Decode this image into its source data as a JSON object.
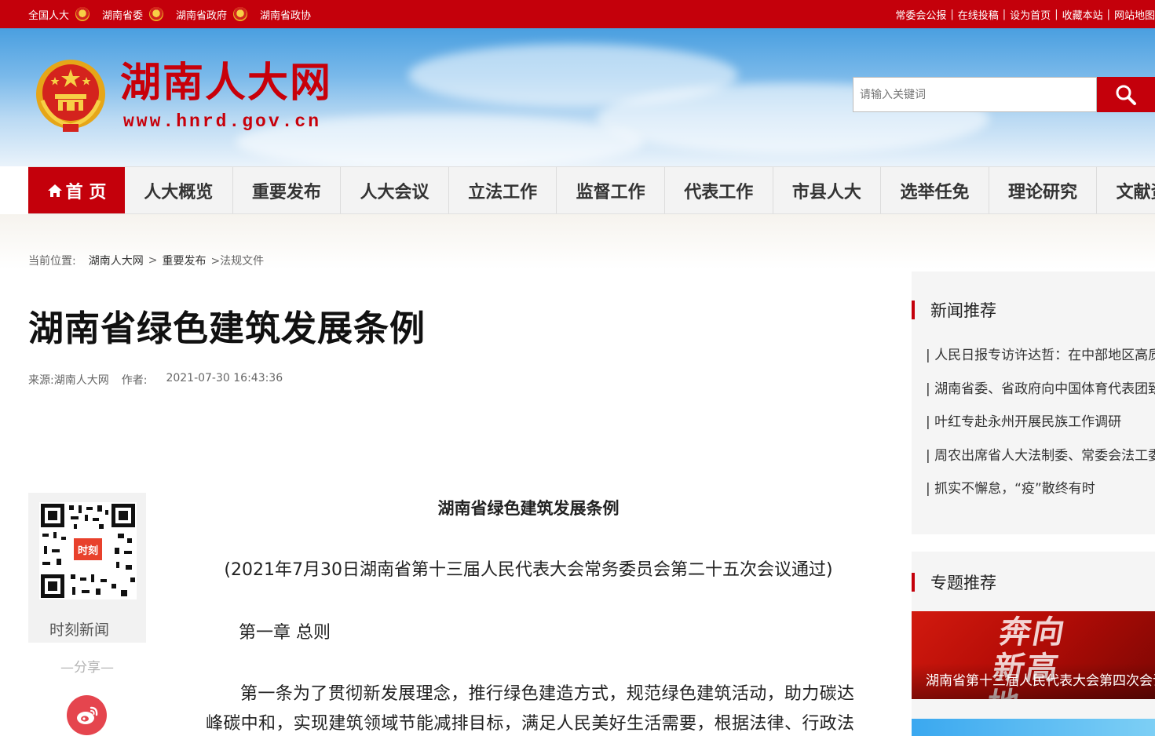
{
  "topbar": {
    "left_links": [
      "全国人大",
      "湖南省委",
      "湖南省政府",
      "湖南省政协"
    ],
    "right_links": [
      "常委会公报",
      "在线投稿",
      "设为首页",
      "收藏本站",
      "网站地图"
    ],
    "separator": "|"
  },
  "header": {
    "site_title": "湖南人大网",
    "site_url": "www.hnrd.gov.cn",
    "search_placeholder": "请输入关键词"
  },
  "nav": {
    "home_label": "首 页",
    "items": [
      "人大概览",
      "重要发布",
      "人大会议",
      "立法工作",
      "监督工作",
      "代表工作",
      "市县人大",
      "选举任免",
      "理论研究",
      "文献资料"
    ]
  },
  "breadcrumb": {
    "label": "当前位置:",
    "items": [
      "湖南人大网",
      "重要发布",
      ">法规文件"
    ],
    "arrow": ">"
  },
  "article": {
    "title": "湖南省绿色建筑发展条例",
    "source": "来源:湖南人大网",
    "author": "作者:",
    "datetime": "2021-07-30 16:43:36",
    "content_title": "湖南省绿色建筑发展条例",
    "subtitle": "(2021年7月30日湖南省第十三届人民代表大会常务委员会第二十五次会议通过)",
    "chapter": "第一章 总则",
    "paragraph1": "第一条为了贯彻新发展理念，推行绿色建造方式，规范绿色建筑活动，助力碳达峰碳中和，实现建筑领域节能减排目标，满足人民美好生活需要，根据法律、行政法规，结合本省实际，制定本条例。"
  },
  "share_panel": {
    "qr_label": "时刻新闻",
    "qr_logo_text": "时刻",
    "share_text": "—分享—"
  },
  "sidebar": {
    "news_title": "新闻推荐",
    "news_items": [
      "| 人民日报专访许达哲：在中部地区高质量发展中彰显湖南担当",
      "| 湖南省委、省政府向中国体育代表团致贺电",
      "| 叶红专赴永州开展民族工作调研",
      "| 周农出席省人大法制委、常委会法工委会议",
      "| 抓实不懈怠，“疫”散终有时"
    ],
    "topic_title": "专题推荐",
    "topic_banner_text": "奔向新高地",
    "topic_caption": "湖南省第十三届人民代表大会第四次会议"
  },
  "colors": {
    "brand_red": "#c4000b",
    "nav_bg": "#f3f3f3",
    "sidebar_bg": "#f5f5f5"
  }
}
